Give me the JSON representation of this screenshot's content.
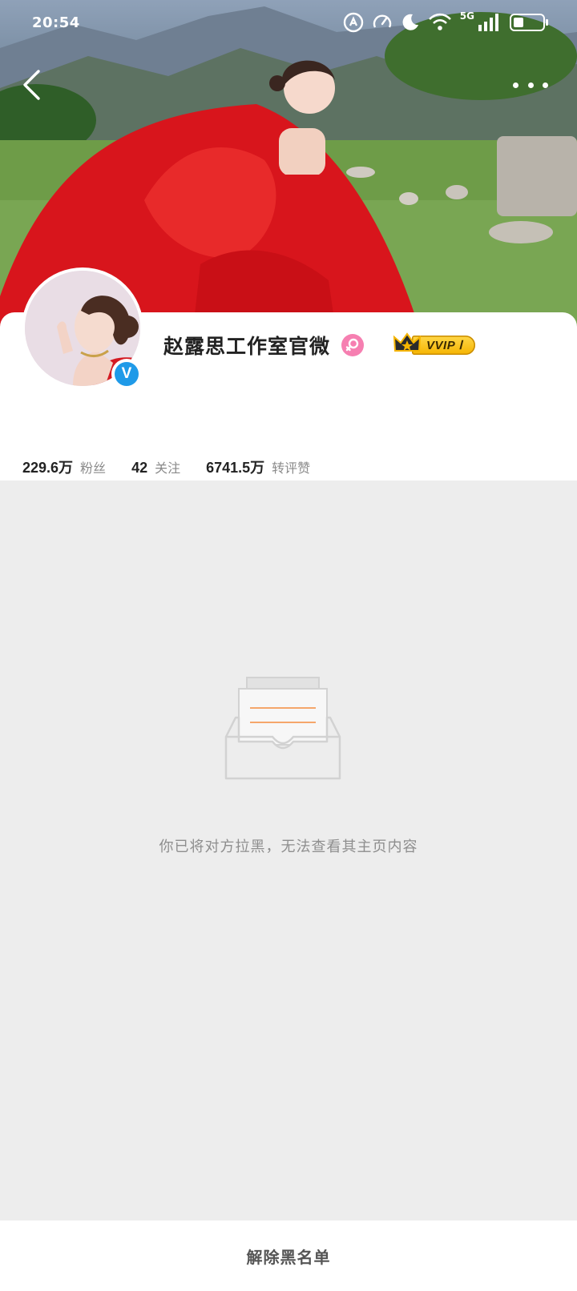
{
  "status_bar": {
    "time": "20:54",
    "network": "5G",
    "battery_level": 0.35
  },
  "header": {
    "back_icon": "chevron-left-icon",
    "more_icon": "more-dots-icon"
  },
  "profile": {
    "name": "赵露思工作室官微",
    "gender_icon": "female-icon",
    "vip_label": "VVIP Ⅰ",
    "verified_mark": "V",
    "verified_color": "#1f9ae8",
    "stats": [
      {
        "value": "229.6万",
        "label": "粉丝"
      },
      {
        "value": "42",
        "label": "关注"
      },
      {
        "value": "6741.5万",
        "label": "转评赞"
      }
    ]
  },
  "blocked": {
    "message": "你已将对方拉黑，无法查看其主页内容",
    "illustration_icon": "empty-inbox-icon"
  },
  "bottom_action": {
    "label": "解除黑名单"
  },
  "colors": {
    "page_bg": "#ededed",
    "accent_orange": "#f5a66b",
    "gender_pink": "#f67fb1",
    "vip_gold": "#f5b400"
  }
}
